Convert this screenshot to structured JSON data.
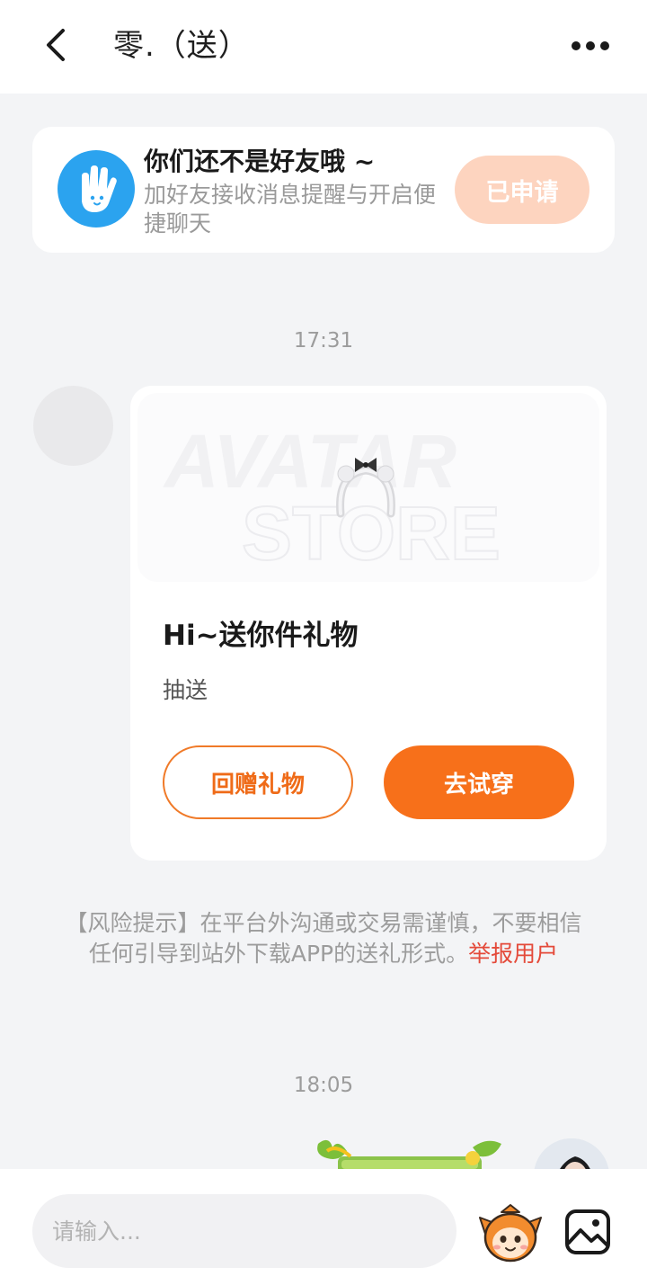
{
  "header": {
    "title": "零.（送）",
    "back_icon": "chevron-left-icon",
    "more_icon": "more-dots-icon"
  },
  "friend_notice": {
    "title": "你们还不是好友哦 ~",
    "description": "加好友接收消息提醒与开启便捷聊天",
    "button_label": "已申请",
    "icon": "hand-wave-icon"
  },
  "messages": {
    "time_1": "17:31",
    "time_2": "18:05"
  },
  "gift_card": {
    "banner_text_1": "AVATAR",
    "banner_text_2": "STORE",
    "title": "Hi~送你件礼物",
    "subtitle": "抽送",
    "return_gift_label": "回赠礼物",
    "try_on_label": "去试穿"
  },
  "risk_notice": {
    "text": "【风险提示】在平台外沟通或交易需谨慎，不要相信任何引导到站外下载APP的送礼形式。",
    "report_link": "举报用户"
  },
  "input_bar": {
    "placeholder": "请输入...",
    "sticker_icon": "sticker-face-icon",
    "image_icon": "image-icon"
  },
  "colors": {
    "accent": "#f7701a",
    "accent_light": "#fdd4bf",
    "report_red": "#e44a3a",
    "friend_icon_blue": "#2ba3ef"
  }
}
